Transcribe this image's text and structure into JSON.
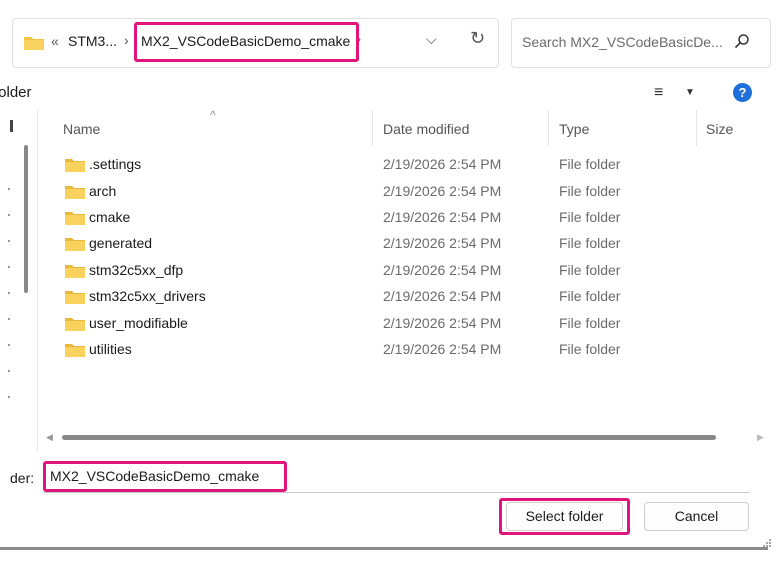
{
  "address": {
    "overflow_glyph": "«",
    "crumbs": [
      "STM3...",
      "MX2_VSCodeBasicDemo_cmake"
    ],
    "separator": "›",
    "dropdown_glyph": "⌵",
    "refresh_glyph": "↻"
  },
  "search": {
    "placeholder": "Search MX2_VSCodeBasicDe..."
  },
  "toolbar": {
    "label": "folder",
    "view_glyph": "≡",
    "view_chev": "▼",
    "help_glyph": "?"
  },
  "columns": {
    "name": "Name",
    "date": "Date modified",
    "type": "Type",
    "size": "Size",
    "sort_caret": "^"
  },
  "files": [
    {
      "name": ".settings",
      "date": "2/19/2026 2:54 PM",
      "type": "File folder"
    },
    {
      "name": "arch",
      "date": "2/19/2026 2:54 PM",
      "type": "File folder"
    },
    {
      "name": "cmake",
      "date": "2/19/2026 2:54 PM",
      "type": "File folder"
    },
    {
      "name": "generated",
      "date": "2/19/2026 2:54 PM",
      "type": "File folder"
    },
    {
      "name": "stm32c5xx_dfp",
      "date": "2/19/2026 2:54 PM",
      "type": "File folder"
    },
    {
      "name": "stm32c5xx_drivers",
      "date": "2/19/2026 2:54 PM",
      "type": "File folder"
    },
    {
      "name": "user_modifiable",
      "date": "2/19/2026 2:54 PM",
      "type": "File folder"
    },
    {
      "name": "utilities",
      "date": "2/19/2026 2:54 PM",
      "type": "File folder"
    }
  ],
  "scroll": {
    "left_glyph": "◀",
    "right_glyph": "▶"
  },
  "folder_field": {
    "label": "der:",
    "value": "MX2_VSCodeBasicDemo_cmake"
  },
  "buttons": {
    "select": "Select folder",
    "cancel": "Cancel"
  },
  "colors": {
    "highlight": "#e0147c",
    "folder_icon": "#f4c542",
    "help_icon": "#1e6fd9"
  }
}
